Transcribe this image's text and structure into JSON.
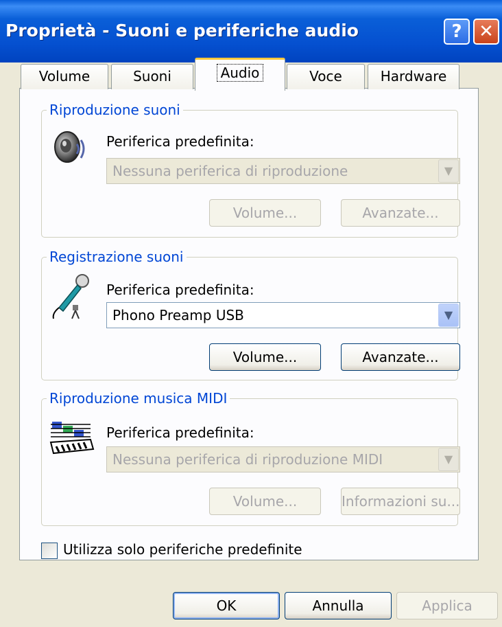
{
  "window": {
    "title": "Proprietà - Suoni e periferiche audio",
    "help_glyph": "?",
    "close_glyph": "✕"
  },
  "tabs": [
    {
      "label": "Volume",
      "selected": false
    },
    {
      "label": "Suoni",
      "selected": false
    },
    {
      "label": "Audio",
      "selected": true
    },
    {
      "label": "Voce",
      "selected": false
    },
    {
      "label": "Hardware",
      "selected": false
    }
  ],
  "playback": {
    "group_label": "Riproduzione suoni",
    "icon": "speaker-icon",
    "device_label": "Periferica predefinita:",
    "device_value": "Nessuna periferica di riproduzione",
    "enabled": false,
    "volume_button": "Volume...",
    "advanced_button": "Avanzate..."
  },
  "recording": {
    "group_label": "Registrazione suoni",
    "icon": "microphone-icon",
    "device_label": "Periferica predefinita:",
    "device_value": "Phono Preamp USB",
    "enabled": true,
    "volume_button": "Volume...",
    "advanced_button": "Avanzate..."
  },
  "midi": {
    "group_label": "Riproduzione musica MIDI",
    "icon": "midi-keyboard-icon",
    "device_label": "Periferica predefinita:",
    "device_value": "Nessuna periferica di riproduzione MIDI",
    "enabled": false,
    "volume_button": "Volume...",
    "about_button": "Informazioni su..."
  },
  "default_only": {
    "label": "Utilizza solo periferiche predefinite",
    "checked": false
  },
  "footer": {
    "ok": "OK",
    "cancel": "Annulla",
    "apply": "Applica"
  },
  "colors": {
    "titlebar": "#0a5fd8",
    "group_label": "#0046d5",
    "dialog_bg": "#ece9d8",
    "active_tab_accent": "#ffc83c"
  }
}
